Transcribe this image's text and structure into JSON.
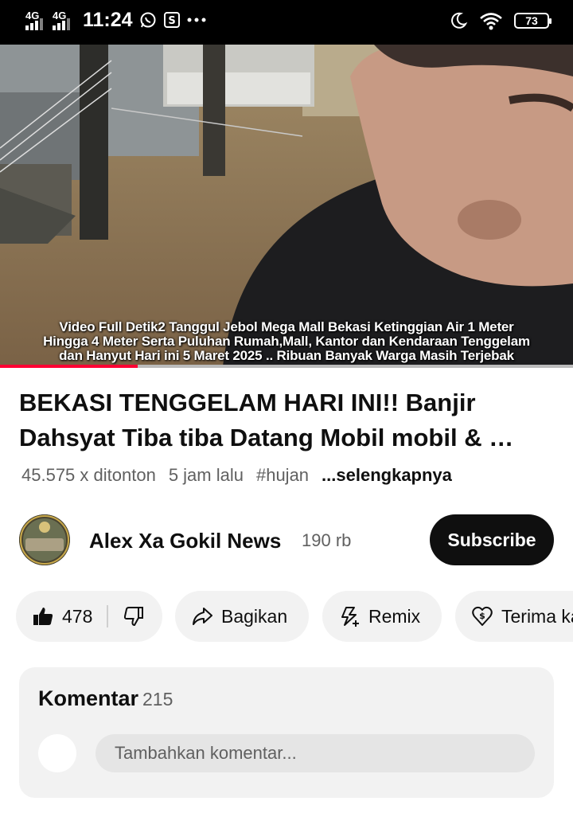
{
  "status_bar": {
    "network_1": "4G",
    "network_2": "4G",
    "time": "11:24",
    "battery": "73"
  },
  "video": {
    "caption_lines": [
      "Video Full Detik2 Tanggul Jebol Mega Mall Bekasi Ketinggian Air 1 Meter",
      "Hingga 4 Meter Serta Puluhan Rumah,Mall, Kantor dan Kendaraan Tenggelam",
      "dan Hanyut Hari ini 5 Maret 2025 .. Ribuan Banyak Warga Masih Terjebak"
    ],
    "progress_fraction": 0.24,
    "progress_color": "#ff0033"
  },
  "title": "BEKASI TENGGELAM HARI INI!! Banjir Dahsyat Tiba tiba Datang Mobil mobil & …",
  "meta": {
    "views": "45.575 x ditonton",
    "age": "5 jam lalu",
    "hashtag": "#hujan",
    "more": "...selengkapnya"
  },
  "channel": {
    "name": "Alex Xa Gokil News",
    "subscribers": "190 rb",
    "subscribe_label": "Subscribe",
    "avatar_text": "Alex Xa Gokil News"
  },
  "actions": {
    "like_count": "478",
    "share_label": "Bagikan",
    "remix_label": "Remix",
    "thanks_label": "Terima kasih"
  },
  "comments": {
    "title": "Komentar",
    "count": "215",
    "placeholder": "Tambahkan komentar..."
  },
  "icons": {
    "like": "thumbs-up-icon",
    "dislike": "thumbs-down-icon",
    "share": "share-arrow-icon",
    "remix": "remix-icon",
    "thanks": "heart-dollar-icon",
    "dnd": "moon-icon",
    "wifi": "wifi-icon",
    "whatsapp": "whatsapp-icon"
  }
}
